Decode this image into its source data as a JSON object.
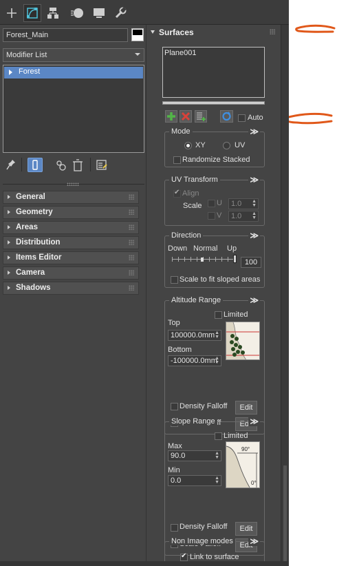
{
  "object_name": "Forest_Main",
  "object_color": "#000000",
  "modifier_list": {
    "label": "Modifier List"
  },
  "stack": {
    "items": [
      "Forest"
    ]
  },
  "rollouts": [
    "General",
    "Geometry",
    "Areas",
    "Distribution",
    "Items Editor",
    "Camera",
    "Shadows"
  ],
  "surfaces": {
    "title": "Surfaces",
    "list": [
      "Plane001"
    ],
    "auto_label": "Auto"
  },
  "mode": {
    "title": "Mode",
    "collapse": "≫",
    "xy": "XY",
    "uv": "UV",
    "randomize": "Randomize Stacked",
    "selected": "XY"
  },
  "uv_transform": {
    "title": "UV Transform",
    "collapse": "≫",
    "align": "Align",
    "scale": "Scale",
    "u": "U",
    "v": "V",
    "u_value": "1.0",
    "v_value": "1.0"
  },
  "direction": {
    "title": "Direction",
    "collapse": "≫",
    "down": "Down",
    "normal": "Normal",
    "up": "Up",
    "value": "100",
    "scale_fit": "Scale to fit sloped areas"
  },
  "altitude": {
    "title": "Altitude Range",
    "collapse": "≫",
    "limited": "Limited",
    "top": "Top",
    "top_value": "100000.0mm",
    "bottom": "Bottom",
    "bottom_value": "-100000.0mm",
    "density_falloff": "Density Falloff",
    "scale_falloff": "Scale Falloff",
    "edit": "Edit"
  },
  "slope": {
    "title": "Slope Range",
    "collapse": "≫",
    "limited": "Limited",
    "max": "Max",
    "max_value": "90.0",
    "min": "Min",
    "min_value": "0.0",
    "density_falloff": "Density Falloff",
    "scale_falloff": "Scale Falloff",
    "edit": "Edit",
    "thumb_max": "90°",
    "thumb_min": "0°"
  },
  "non_image": {
    "title": "Non Image modes",
    "collapse": "≫",
    "link": "Link to surface"
  },
  "colors": {
    "panel_bg": "#444444",
    "selected_item": "#5b87c5",
    "annotation": "#e0581a"
  }
}
